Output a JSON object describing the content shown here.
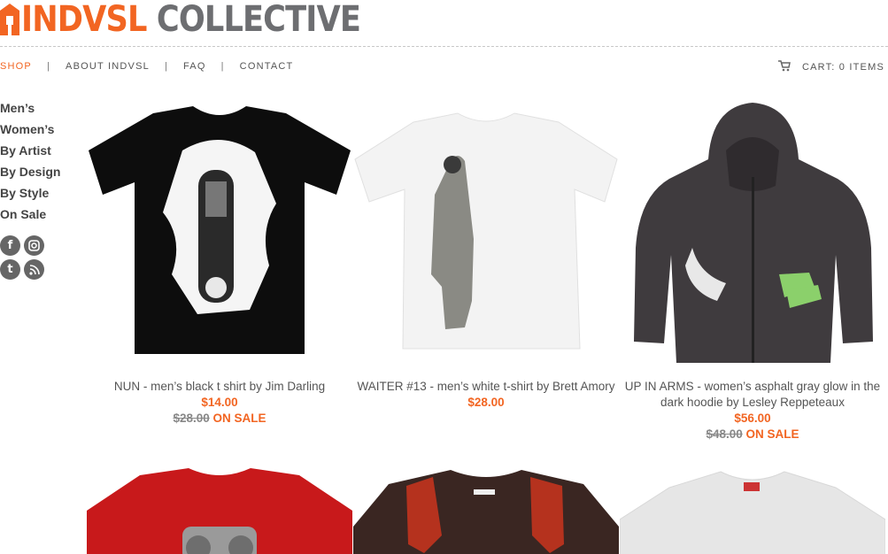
{
  "header": {
    "logo_orange": "INDVSL",
    "logo_gray": " COLLECTIVE",
    "brand_orange": "#f26522",
    "brand_gray": "#6d6e71"
  },
  "nav": {
    "items": [
      {
        "label": "SHOP",
        "active": true
      },
      {
        "label": "ABOUT INDVSL"
      },
      {
        "label": "FAQ"
      },
      {
        "label": "CONTACT"
      }
    ],
    "separator": "|"
  },
  "cart": {
    "icon": "shopping-cart-icon",
    "label": "CART: 0 ITEMS"
  },
  "sidebar": {
    "items": [
      {
        "label": "Men’s"
      },
      {
        "label": "Women’s"
      },
      {
        "label": "By Artist"
      },
      {
        "label": "By Design"
      },
      {
        "label": "By Style"
      },
      {
        "label": "On Sale"
      }
    ],
    "social": [
      {
        "icon": "facebook-icon",
        "glyph": "f"
      },
      {
        "icon": "instagram-icon",
        "glyph": "◎"
      },
      {
        "icon": "tumblr-icon",
        "glyph": "t"
      },
      {
        "icon": "rss-icon",
        "glyph": "◝"
      }
    ]
  },
  "products": [
    {
      "name": "NUN - men’s black t shirt by Jim Darling",
      "price": "$14.00",
      "was": "$28.00",
      "sale": "ON SALE"
    },
    {
      "name": "WAITER #13 - men’s white t-shirt by Brett Amory",
      "price": "$28.00"
    },
    {
      "name": "UP IN ARMS - women’s asphalt gray glow in the dark hoodie by Lesley Reppeteaux",
      "price": "$56.00",
      "was": "$48.00",
      "sale": "ON SALE"
    }
  ]
}
